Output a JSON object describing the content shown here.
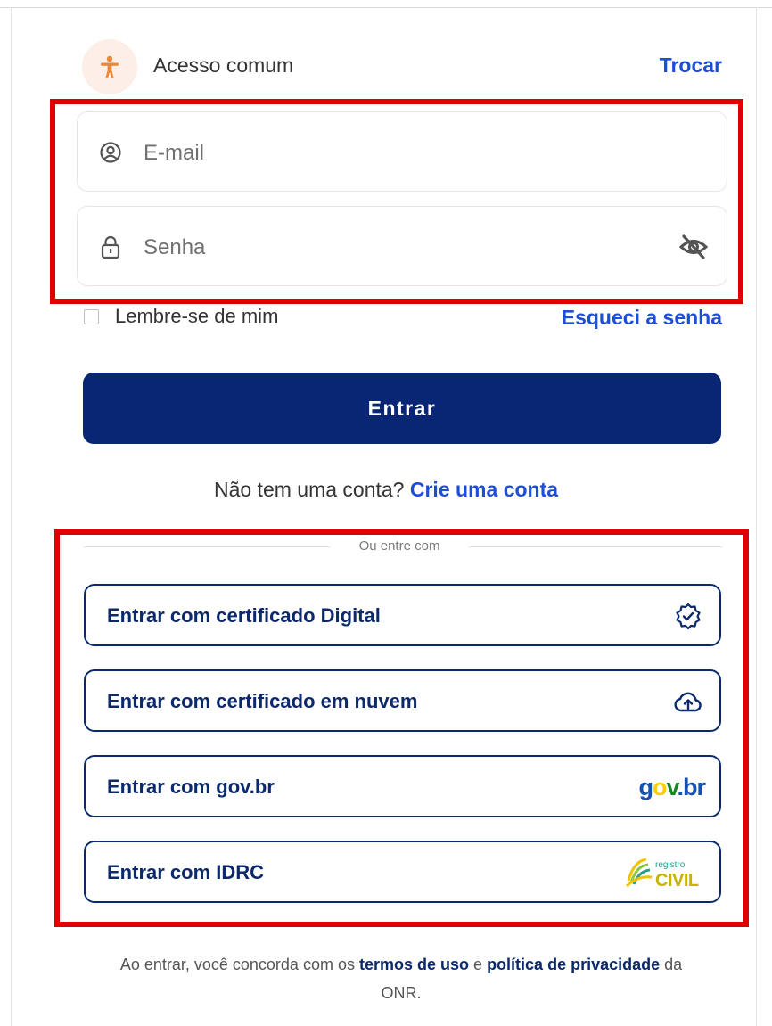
{
  "access": {
    "icon": "accessibility-person-icon",
    "label": "Acesso comum",
    "switch_label": "Trocar"
  },
  "login_form": {
    "email": {
      "icon": "user-circle-icon",
      "placeholder": "E-mail",
      "value": ""
    },
    "password": {
      "icon": "lock-icon",
      "placeholder": "Senha",
      "value": "",
      "toggle_icon": "eye-off-icon"
    },
    "remember_label": "Lembre-se de mim",
    "remember_checked": false,
    "forgot_label": "Esqueci a senha",
    "submit_label": "Entrar"
  },
  "signup": {
    "prompt": "Não tem uma conta?",
    "link": "Crie uma conta"
  },
  "alt_login": {
    "divider_label": "Ou entre com",
    "options": [
      {
        "label": "Entrar com certificado Digital",
        "icon": "certificate-badge-icon"
      },
      {
        "label": "Entrar com certificado em nuvem",
        "icon": "cloud-upload-icon"
      },
      {
        "label": "Entrar com gov.br",
        "logo": "govbr-logo",
        "logo_text": "gov.br"
      },
      {
        "label": "Entrar com IDRC",
        "logo": "registro-civil-logo",
        "logo_text": "registro CIVIL"
      }
    ]
  },
  "footer": {
    "prefix": "Ao entrar, você concorda com os",
    "terms_link": "termos de uso",
    "conjunction": "e",
    "privacy_link": "política de privacidade",
    "suffix": "da ONR."
  },
  "colors": {
    "primary_navy": "#082673",
    "link_blue": "#1d4ed8",
    "highlight_red": "#e00000",
    "access_icon_orange": "#e8893a",
    "access_badge_bg": "#fdeee7"
  }
}
